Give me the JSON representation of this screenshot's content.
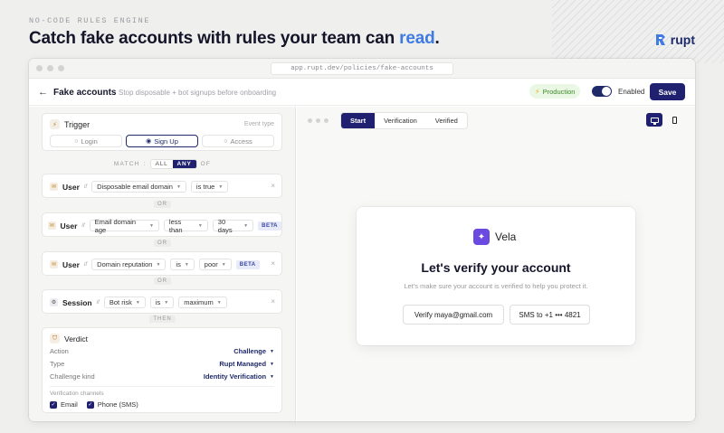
{
  "header": {
    "eyebrow": "NO-CODE RULES ENGINE",
    "headline_before": "Catch fake accounts with rules your team can ",
    "headline_accent": "read",
    "headline_after": ".",
    "brand": "rupt",
    "brand_color": "#1f2a6b",
    "accent_color": "#3f7be0"
  },
  "browser": {
    "url": "app.rupt.dev/policies/fake-accounts"
  },
  "toolbar": {
    "back_icon": "arrow-left-icon",
    "title": "Fake accounts",
    "subtitle": "Stop disposable + bot signups before onboarding",
    "env_badge": "Production",
    "enabled_label": "Enabled",
    "enabled": true,
    "save_label": "Save",
    "primary_color": "#1f2170"
  },
  "trigger": {
    "title": "Trigger",
    "event_type_label": "Event type",
    "options": [
      {
        "label": "Login",
        "active": false
      },
      {
        "label": "Sign Up",
        "active": true
      },
      {
        "label": "Access",
        "active": false
      }
    ]
  },
  "match": {
    "prefix": "MATCH",
    "all": "ALL",
    "any": "ANY",
    "suffix": "OF",
    "selected": "ANY"
  },
  "conditions": [
    {
      "subject": "User",
      "if": "if",
      "field": "Disposable email domain",
      "operator": "is true",
      "value": null,
      "beta": false
    },
    {
      "subject": "User",
      "if": "if",
      "field": "Email domain age",
      "operator": "less than",
      "value": "30 days",
      "beta": true
    },
    {
      "subject": "User",
      "if": "if",
      "field": "Domain reputation",
      "operator": "is",
      "value": "poor",
      "beta": true
    },
    {
      "subject": "Session",
      "if": "if",
      "field": "Bot risk",
      "operator": "is",
      "value": "maximum",
      "beta": false
    }
  ],
  "connectors": {
    "or": "OR",
    "then": "THEN",
    "beta": "BETA",
    "close": "×"
  },
  "verdict": {
    "title": "Verdict",
    "rows": [
      {
        "key": "Action",
        "value": "Challenge"
      },
      {
        "key": "Type",
        "value": "Rupt Managed"
      },
      {
        "key": "Challenge kind",
        "value": "Identity Verification"
      }
    ],
    "channels_label": "Verification channels",
    "channels": [
      {
        "label": "Email",
        "checked": true
      },
      {
        "label": "Phone (SMS)",
        "checked": true
      }
    ]
  },
  "preview": {
    "tabs": [
      {
        "label": "Start",
        "active": true
      },
      {
        "label": "Verification",
        "active": false
      },
      {
        "label": "Verified",
        "active": false
      }
    ],
    "devices": [
      "desktop-icon",
      "mobile-icon"
    ],
    "card": {
      "brand": "Vela",
      "brand_color": "#6a4ae0",
      "title": "Let's verify your account",
      "subtitle": "Let's make sure your account is verified to help you protect it.",
      "email_button": "Verify maya@gmail.com",
      "sms_button": "SMS to +1 ••• 4821"
    }
  }
}
